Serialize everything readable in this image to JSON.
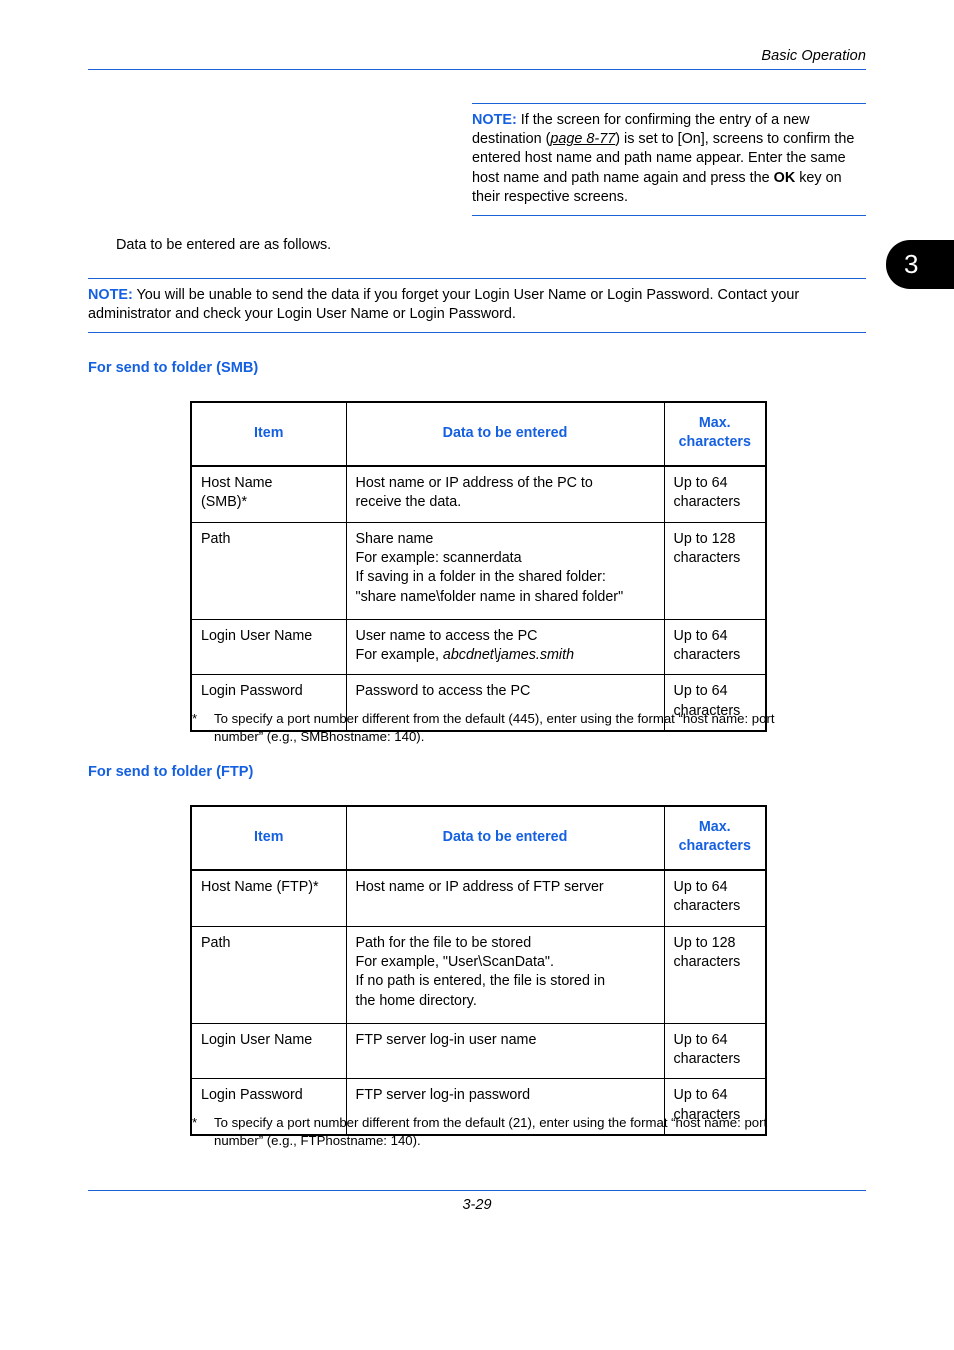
{
  "header": {
    "title": "Basic Operation"
  },
  "chapter_tab": {
    "number": "3"
  },
  "notes": {
    "top": {
      "label": "NOTE:",
      "part1": " If the screen for confirming the entry of a new destination (",
      "reference": "page 8-77",
      "part2": ") is set to [On], screens to confirm the entered host name and path name appear. Enter the same host name and path name again and press the ",
      "keyword": "OK",
      "part3": " key on their respective screens."
    },
    "login": {
      "label": "NOTE:",
      "text": " You will be unable to send the data if you forget your Login User Name or Login Password. Contact your administrator and check your Login User Name or Login Password."
    }
  },
  "body": {
    "intro": "Data to be entered are as follows."
  },
  "sections": {
    "smb": {
      "heading": "For send to folder (SMB)",
      "table": {
        "headers": {
          "item": "Item",
          "data": "Data to be entered",
          "max_line1": "Max.",
          "max_line2": "characters"
        },
        "rows": [
          {
            "item_line1": "Host Name",
            "item_line2": "(SMB)*",
            "data_line1": "Host name or IP address of the PC to",
            "data_line2": "receive the data.",
            "data_line3": "",
            "data_line4": "",
            "max_line1": "Up to 64",
            "max_line2": "characters"
          },
          {
            "item_line1": "Path",
            "item_line2": "",
            "data_line1": "Share name",
            "data_line2": "For example: scannerdata",
            "data_line3": "If saving in a folder in the shared folder:",
            "data_line4": "\"share name\\folder name in shared folder\"",
            "max_line1": "Up to 128",
            "max_line2": "characters"
          },
          {
            "item_line1": "Login User Name",
            "item_line2": "",
            "data_line1": "User name to access the PC",
            "data_line2_prefix": "For example, ",
            "data_line2_italic": "abcdnet\\james.smith",
            "data_line3": "",
            "data_line4": "",
            "max_line1": "Up to 64",
            "max_line2": "characters"
          },
          {
            "item_line1": "Login Password",
            "item_line2": "",
            "data_line1": "Password to access the PC",
            "data_line2": "",
            "data_line3": "",
            "data_line4": "",
            "max_line1": "Up to 64",
            "max_line2": "characters"
          }
        ]
      },
      "footnote": {
        "marker": "*",
        "text": "To specify a port number different from the default (445), enter using the format “host name: port number” (e.g., SMBhostname: 140)."
      }
    },
    "ftp": {
      "heading": "For send to folder (FTP)",
      "table": {
        "headers": {
          "item": "Item",
          "data": "Data to be entered",
          "max_line1": "Max.",
          "max_line2": "characters"
        },
        "rows": [
          {
            "item_line1": "Host Name (FTP)*",
            "item_line2": "",
            "data_line1": "Host name or IP address of FTP server",
            "data_line2": "",
            "data_line3": "",
            "data_line4": "",
            "max_line1": "Up to 64",
            "max_line2": "characters"
          },
          {
            "item_line1": "Path",
            "item_line2": "",
            "data_line1": "Path for the file to be stored",
            "data_line2": "For example, \"User\\ScanData\".",
            "data_line3": "If no path is entered, the file is stored in",
            "data_line4": "the home directory.",
            "max_line1": "Up to 128",
            "max_line2": "characters"
          },
          {
            "item_line1": "Login User Name",
            "item_line2": "",
            "data_line1": "FTP server log-in user name",
            "data_line2": "",
            "data_line3": "",
            "data_line4": "",
            "max_line1": "Up to 64",
            "max_line2": "characters"
          },
          {
            "item_line1": "Login Password",
            "item_line2": "",
            "data_line1": "FTP server log-in password",
            "data_line2": "",
            "data_line3": "",
            "data_line4": "",
            "max_line1": "Up to 64",
            "max_line2": "characters"
          }
        ]
      },
      "footnote": {
        "marker": "*",
        "text": "To specify a port number different from the default (21), enter using the format “host name: port number” (e.g., FTPhostname: 140)."
      }
    }
  },
  "footer": {
    "page_number": "3-29"
  },
  "colors": {
    "accent_blue": "#1560E0",
    "rule_blue": "#1B62D6",
    "text_black": "#000000",
    "tab_black": "#000000"
  }
}
